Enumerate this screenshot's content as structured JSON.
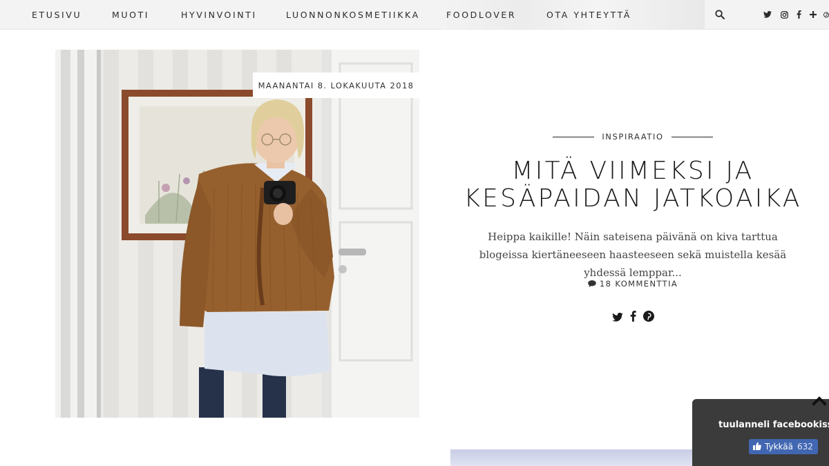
{
  "nav": {
    "items": [
      "ETUSIVU",
      "MUOTI",
      "HYVINVOINTI",
      "LUONNONKOSMETIIKKA",
      "FOODLOVER",
      "OTA YHTEYTTÄ"
    ],
    "icons": [
      "search-icon",
      "twitter-icon",
      "instagram-icon",
      "facebook-icon",
      "plus-icon",
      "pinterest-icon"
    ]
  },
  "post": {
    "date": "MAANANTAI 8. LOKAKUUTA 2018",
    "category": "INSPIRAATIO",
    "title_line1": "MITÄ VIIMEKSI JA",
    "title_line2": "KESÄPAIDAN JATKOAIKA",
    "excerpt": "Heippa kaikille! Näin sateisena päivänä on kiva tarttua blogeissa kiertäneeseen haasteeseen sekä muistella kesää yhdessä lemppar...",
    "comments": "18 KOMMENTTIA",
    "share_icons": [
      "twitter-icon",
      "facebook-icon",
      "pinterest-icon"
    ]
  },
  "facebook_widget": {
    "title": "tuulanneli facebookissa",
    "like_label": "Tykkää",
    "like_count": "632"
  },
  "colors": {
    "nav_bg": "#f3f3f3",
    "text": "#222222",
    "fb_widget_bg": "#3b3b3b",
    "fb_blue": "#4267b2"
  }
}
